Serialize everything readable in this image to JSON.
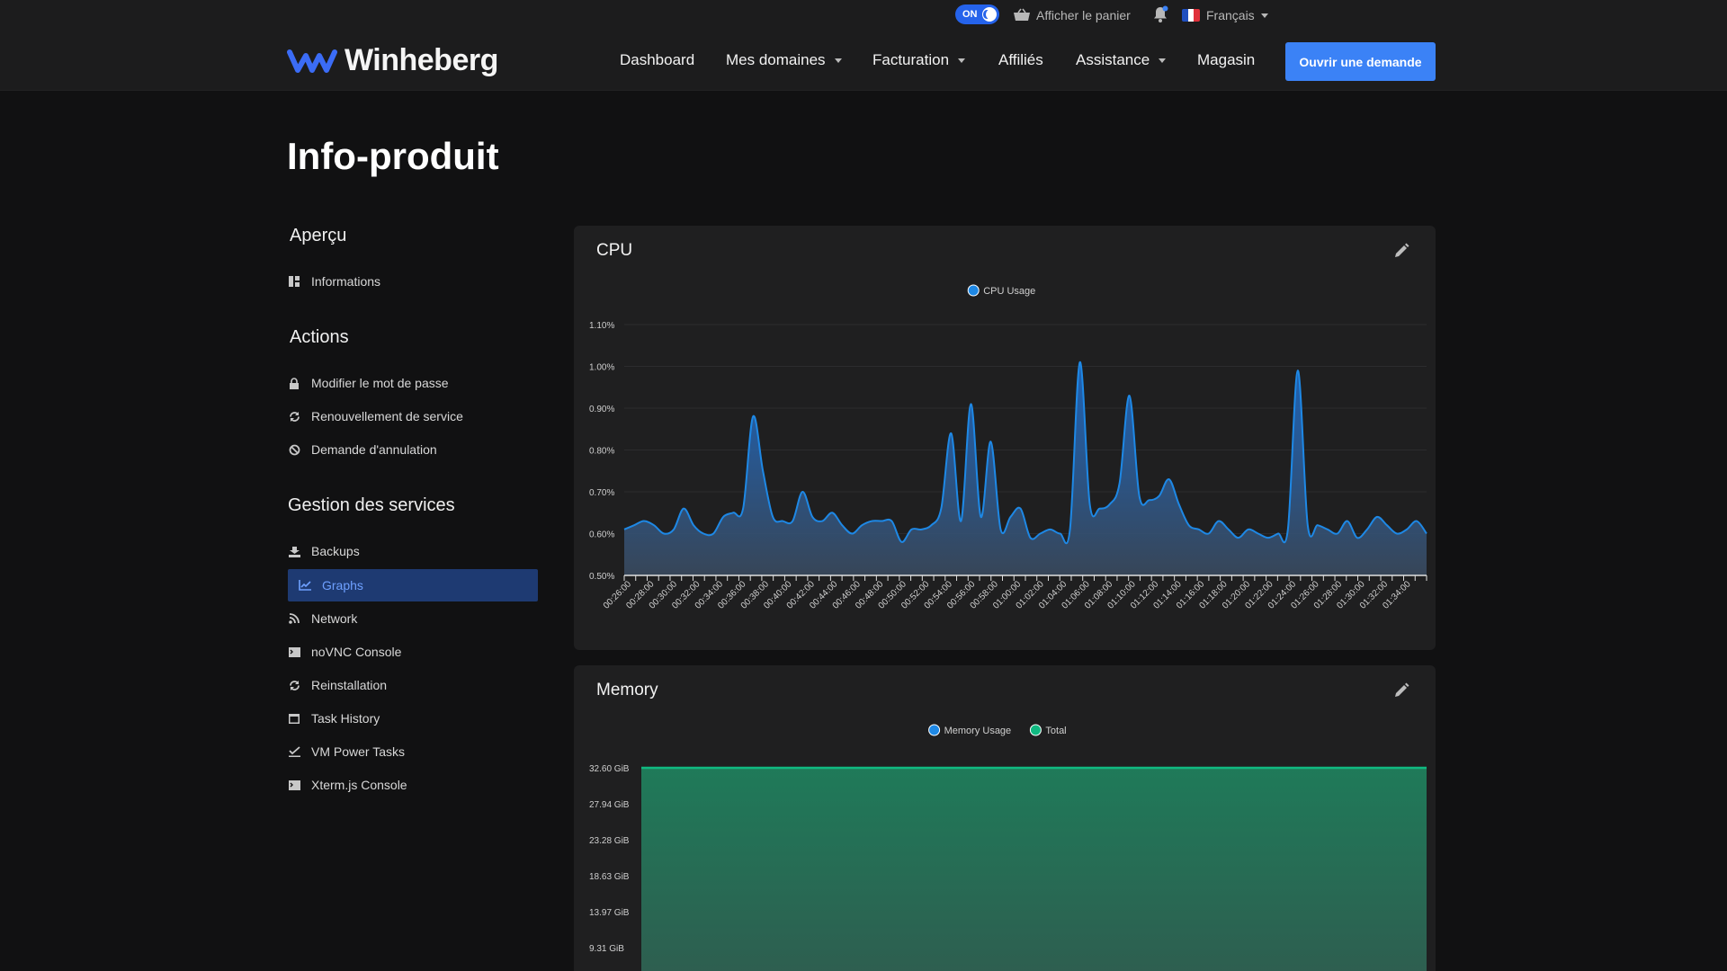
{
  "topbar": {
    "toggle_label": "ON",
    "cart_label": "Afficher le panier",
    "language": "Français"
  },
  "nav": {
    "brand": "Winheberg",
    "items": [
      {
        "label": "Dashboard",
        "has_dropdown": false
      },
      {
        "label": "Mes domaines",
        "has_dropdown": true
      },
      {
        "label": "Facturation",
        "has_dropdown": true
      },
      {
        "label": "Affiliés",
        "has_dropdown": false
      },
      {
        "label": "Assistance",
        "has_dropdown": true
      },
      {
        "label": "Magasin",
        "has_dropdown": false
      }
    ],
    "cta_label": "Ouvrir une demande"
  },
  "page": {
    "title": "Info-produit"
  },
  "sidebar": {
    "sections": [
      {
        "heading": "Aperçu",
        "items": [
          {
            "label": "Informations",
            "icon": "grid-icon"
          }
        ]
      },
      {
        "heading": "Actions",
        "items": [
          {
            "label": "Modifier le mot de passe",
            "icon": "lock-icon"
          },
          {
            "label": "Renouvellement de service",
            "icon": "refresh-icon"
          },
          {
            "label": "Demande d'annulation",
            "icon": "ban-icon"
          }
        ]
      },
      {
        "heading": "Gestion des services",
        "items": [
          {
            "label": "Backups",
            "icon": "download-icon"
          },
          {
            "label": "Graphs",
            "icon": "chart-icon",
            "active": true
          },
          {
            "label": "Network",
            "icon": "rss-icon"
          },
          {
            "label": "noVNC Console",
            "icon": "terminal-icon"
          },
          {
            "label": "Reinstallation",
            "icon": "refresh-icon"
          },
          {
            "label": "Task History",
            "icon": "calendar-icon"
          },
          {
            "label": "VM Power Tasks",
            "icon": "check-icon"
          },
          {
            "label": "Xterm.js Console",
            "icon": "terminal-icon"
          }
        ]
      }
    ]
  },
  "colors": {
    "accent": "#3b82f6",
    "cpu_line": "#1e88e5",
    "memory_total": "#10b981",
    "active_bg": "#1e3a72"
  },
  "chart_data": [
    {
      "type": "area",
      "title": "CPU",
      "legend": [
        "CPU Usage"
      ],
      "legend_position": "top-center",
      "y_ticks": [
        "1.10%",
        "1.00%",
        "0.90%",
        "0.80%",
        "0.70%",
        "0.60%",
        "0.50%"
      ],
      "ylim": [
        0.5,
        1.1
      ],
      "x_ticks": [
        "00:26:00",
        "00:28:00",
        "00:30:00",
        "00:32:00",
        "00:34:00",
        "00:36:00",
        "00:38:00",
        "00:40:00",
        "00:42:00",
        "00:44:00",
        "00:46:00",
        "00:48:00",
        "00:50:00",
        "00:52:00",
        "00:54:00",
        "00:56:00",
        "00:58:00",
        "01:00:00",
        "01:02:00",
        "01:04:00",
        "01:06:00",
        "01:08:00",
        "01:10:00",
        "01:12:00",
        "01:14:00",
        "01:16:00",
        "01:18:00",
        "01:20:00",
        "01:22:00",
        "01:24:00",
        "01:26:00",
        "01:28:00",
        "01:30:00",
        "01:32:00",
        "01:34:00"
      ],
      "series": [
        {
          "name": "CPU Usage",
          "x_start": "00:26:00",
          "x_end": "01:34:30",
          "values": [
            0.61,
            0.62,
            0.63,
            0.62,
            0.6,
            0.61,
            0.66,
            0.62,
            0.6,
            0.6,
            0.64,
            0.65,
            0.66,
            0.88,
            0.75,
            0.64,
            0.63,
            0.63,
            0.7,
            0.64,
            0.63,
            0.65,
            0.62,
            0.6,
            0.62,
            0.63,
            0.63,
            0.63,
            0.58,
            0.61,
            0.61,
            0.62,
            0.66,
            0.84,
            0.63,
            0.91,
            0.64,
            0.82,
            0.61,
            0.64,
            0.66,
            0.59,
            0.6,
            0.61,
            0.6,
            0.61,
            1.01,
            0.67,
            0.66,
            0.67,
            0.72,
            0.93,
            0.69,
            0.68,
            0.69,
            0.73,
            0.67,
            0.62,
            0.61,
            0.6,
            0.63,
            0.61,
            0.59,
            0.61,
            0.6,
            0.59,
            0.6,
            0.61,
            0.99,
            0.62,
            0.62,
            0.61,
            0.6,
            0.63,
            0.59,
            0.61,
            0.64,
            0.62,
            0.6,
            0.61,
            0.63,
            0.6
          ]
        }
      ]
    },
    {
      "type": "area",
      "title": "Memory",
      "legend": [
        "Memory Usage",
        "Total"
      ],
      "legend_position": "top-center",
      "y_ticks": [
        "32.60 GiB",
        "27.94 GiB",
        "23.28 GiB",
        "18.63 GiB",
        "13.97 GiB",
        "9.31 GiB"
      ],
      "series": [
        {
          "name": "Total",
          "value": 32.6
        },
        {
          "name": "Memory Usage"
        }
      ]
    }
  ]
}
